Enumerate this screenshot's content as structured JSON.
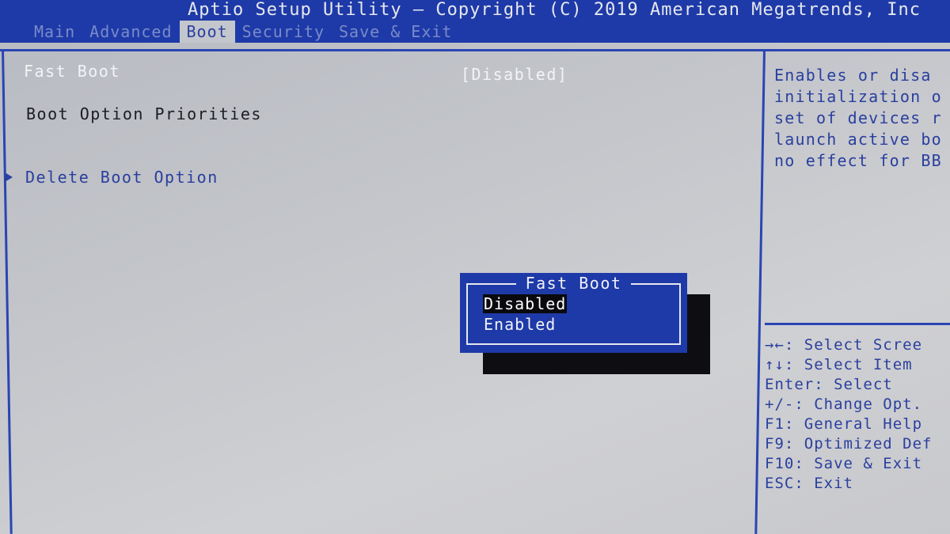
{
  "header": {
    "title": "Aptio Setup Utility – Copyright (C) 2019 American Megatrends, Inc",
    "tabs": [
      {
        "label": "Main"
      },
      {
        "label": "Advanced"
      },
      {
        "label": "Boot"
      },
      {
        "label": "Security"
      },
      {
        "label": "Save & Exit"
      }
    ],
    "active_tab": "Boot"
  },
  "main": {
    "fast_boot_label": "Fast Boot",
    "fast_boot_value": "[Disabled]",
    "boot_option_priorities": "Boot Option Priorities",
    "delete_boot_option": "Delete Boot Option"
  },
  "help": {
    "lines": [
      "Enables or disa",
      "initialization o",
      "set of devices r",
      "launch active bo",
      "no effect for BB"
    ]
  },
  "keys": {
    "lines": [
      "→←: Select Scree",
      "↑↓: Select Item",
      "Enter: Select",
      "+/-: Change Opt.",
      "F1: General Help",
      "F9: Optimized Def",
      "F10: Save & Exit",
      "ESC: Exit"
    ]
  },
  "popup": {
    "title": "Fast Boot",
    "options": [
      {
        "label": "Disabled",
        "selected": true
      },
      {
        "label": "Enabled",
        "selected": false
      }
    ]
  },
  "colors": {
    "bios_blue": "#1e3aa8",
    "background_gray": "#c4c6cb",
    "text_blue": "#2a3f9e",
    "text_white": "#f4f4f6"
  }
}
